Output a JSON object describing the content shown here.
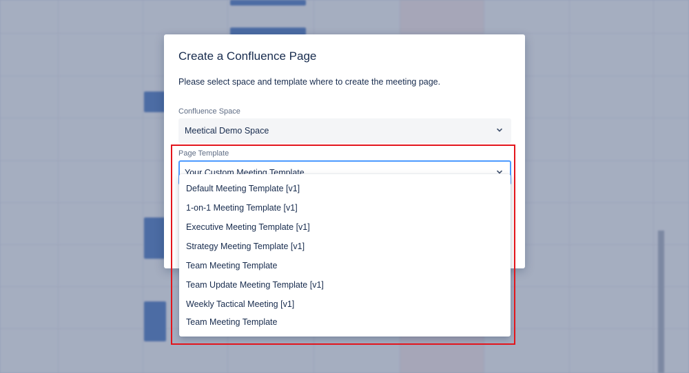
{
  "modal": {
    "title": "Create a Confluence Page",
    "description": "Please select space and template where to create the meeting page.",
    "space_label": "Confluence Space",
    "space_value": "Meetical Demo Space",
    "template_label": "Page Template",
    "template_value": "Your Custom Meeting Template"
  },
  "template_options": [
    "Default Meeting Template [v1]",
    "1-on-1 Meeting Template [v1]",
    "Executive Meeting Template [v1]",
    "Strategy Meeting Template [v1]",
    "Team Meeting Template",
    "Team Update Meeting Template [v1]",
    "Weekly Tactical Meeting [v1]",
    "Team Meeting Template"
  ],
  "colors": {
    "accent": "#4c9aff",
    "annotation": "#e3141b",
    "text": "#172b4d"
  }
}
